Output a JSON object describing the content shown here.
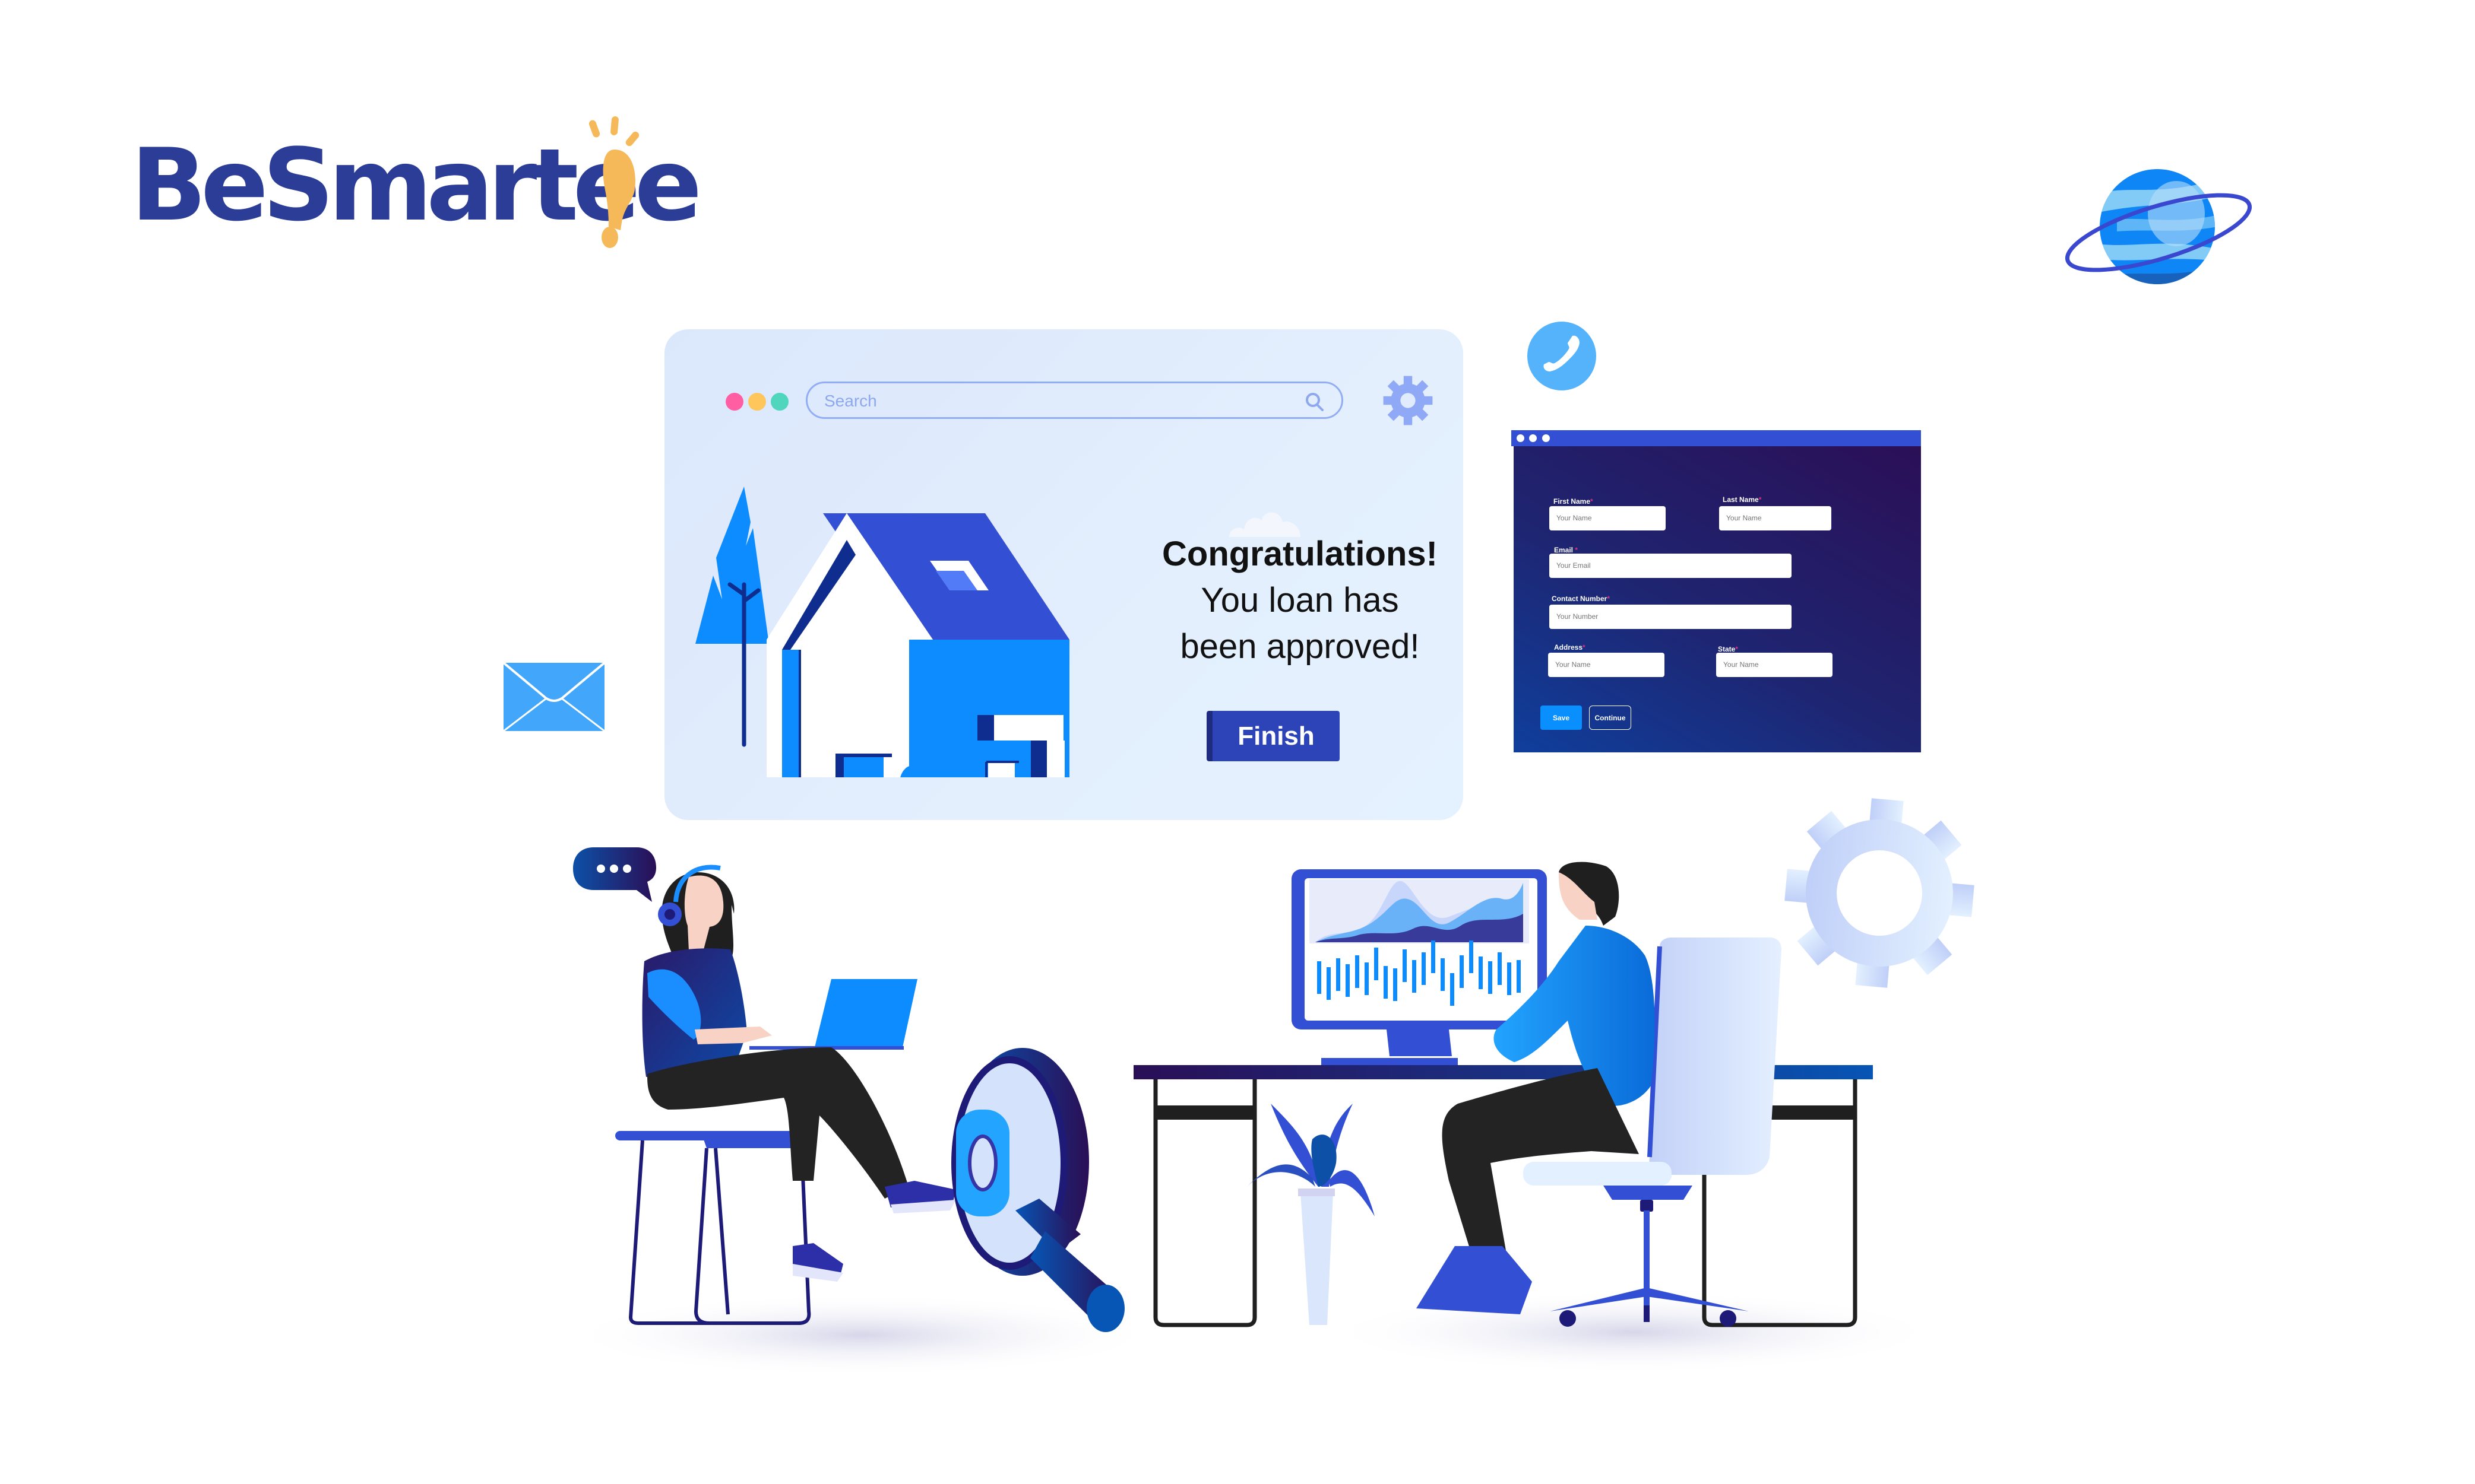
{
  "brand": {
    "name": "BeSmartee",
    "colors": {
      "primary": "#2b3d96",
      "accent": "#f5b95a"
    }
  },
  "browser_card": {
    "window_dots": [
      "#ff5fa2",
      "#ffc65c",
      "#4fd6bd"
    ],
    "search": {
      "placeholder": "Search",
      "icon": "search-icon"
    },
    "settings_icon": "gear-icon",
    "message": {
      "line1": "Congratulations!",
      "line2": "You loan has",
      "line3": "been approved!"
    },
    "finish_label": "Finish",
    "colors": {
      "button": "#2d43b8",
      "border": "#93adf5"
    }
  },
  "form_panel": {
    "fields": {
      "first_name": {
        "label": "First Name",
        "required": "*",
        "placeholder": "Your Name"
      },
      "last_name": {
        "label": "Last Name",
        "required": "*",
        "placeholder": "Your Name"
      },
      "email": {
        "label": "Email",
        "required": "*",
        "placeholder": "Your Email"
      },
      "contact": {
        "label": "Contact  Number",
        "required": "*",
        "placeholder": "Your Number"
      },
      "address": {
        "label": "Address",
        "required": "*",
        "placeholder": "Your Name"
      },
      "state": {
        "label": "State",
        "required": "*",
        "placeholder": "Your Name"
      }
    },
    "save_label": "Save",
    "continue_label": "Continue",
    "colors": {
      "save": "#0a8fff",
      "header": "#3350d4",
      "required": "#e0307c"
    }
  },
  "decorations": {
    "icons": [
      "phone-icon",
      "planet-icon",
      "mail-icon",
      "gear-icon",
      "chat-bubble-icon",
      "magnifier-icon",
      "plant-icon"
    ],
    "chat_bubble_text": "•••"
  }
}
